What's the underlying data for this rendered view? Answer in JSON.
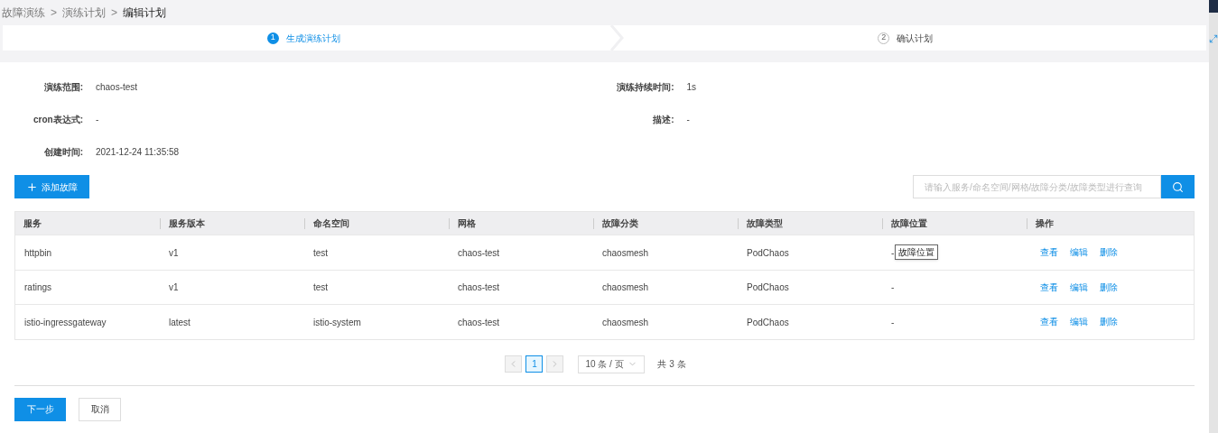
{
  "breadcrumb": [
    {
      "label": "故障演练",
      "current": false
    },
    {
      "label": "演练计划",
      "current": false
    },
    {
      "label": "编辑计划",
      "current": true
    }
  ],
  "breadcrumb_separator": ">",
  "steps": [
    {
      "number": "1",
      "label": "生成演练计划",
      "selected": true
    },
    {
      "number": "2",
      "label": "确认计划",
      "selected": false
    }
  ],
  "details": [
    {
      "label": "演练范围:",
      "value": "chaos-test"
    },
    {
      "label": "演练持续时间:",
      "value": "1s"
    },
    {
      "label": "cron表达式:",
      "value": "-"
    },
    {
      "label": "描述:",
      "value": "-"
    },
    {
      "label": "创建时间:",
      "value": "2021-12-24 11:35:58"
    }
  ],
  "add_button": "添加故障",
  "search": {
    "placeholder": "请输入服务/命名空间/网格/故障分类/故障类型进行查询"
  },
  "table": {
    "columns": [
      "服务",
      "服务版本",
      "命名空间",
      "网格",
      "故障分类",
      "故障类型",
      "故障位置",
      "操作"
    ],
    "rows": [
      {
        "cells": [
          "httpbin",
          "v1",
          "test",
          "chaos-test",
          "chaosmesh",
          "PodChaos",
          "-"
        ],
        "actions": [
          "查看",
          "编辑",
          "删除"
        ],
        "tooltip": "故障位置"
      },
      {
        "cells": [
          "ratings",
          "v1",
          "test",
          "chaos-test",
          "chaosmesh",
          "PodChaos",
          "-"
        ],
        "actions": [
          "查看",
          "编辑",
          "删除"
        ]
      },
      {
        "cells": [
          "istio-ingressgateway",
          "latest",
          "istio-system",
          "chaos-test",
          "chaosmesh",
          "PodChaos",
          "-"
        ],
        "actions": [
          "查看",
          "编辑",
          "删除"
        ]
      }
    ]
  },
  "pagination": {
    "pages": [
      {
        "label": "1",
        "selected": true
      }
    ],
    "page_size": "10 条 / 页",
    "total": "共 3 条"
  },
  "footer_buttons": [
    {
      "label": "下一步",
      "kind": "primary"
    },
    {
      "label": "取消",
      "kind": "default"
    }
  ]
}
